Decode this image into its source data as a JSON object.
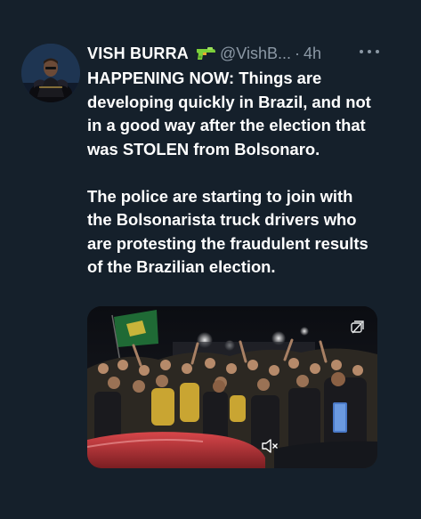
{
  "author": {
    "name": "VISH BURRA",
    "handle": "@VishB...",
    "separator": "·",
    "time": "4h"
  },
  "icons": {
    "name_emoji": "water-pistol-icon",
    "more": "more-options-icon",
    "gif": "gif-toggle-icon",
    "mute": "speaker-muted-icon"
  },
  "tweet": {
    "paragraphs": [
      "HAPPENING NOW: Things are developing quickly in Brazil, and not in a good way after the election that was STOLEN from Bolsonaro.",
      "The police are starting to join with the Bolsonarista truck drivers who are protesting the fraudulent results of the Brazilian election."
    ]
  },
  "colors": {
    "background": "#15202b",
    "text": "#ffffff",
    "secondary_text": "#8b98a5"
  }
}
